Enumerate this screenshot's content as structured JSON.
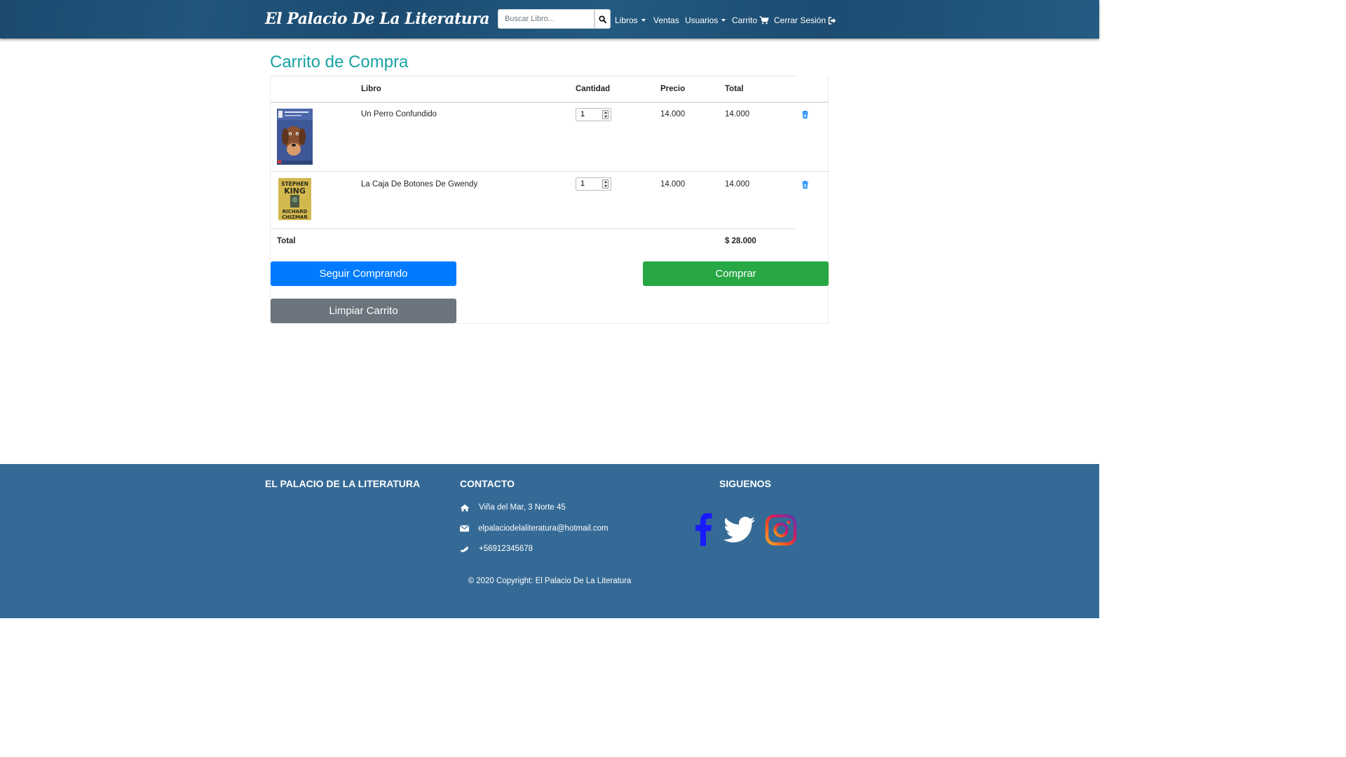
{
  "navbar": {
    "brand": "El Palacio De La Literatura",
    "search_placeholder": "Buscar Libro...",
    "items": {
      "libros": "Libros",
      "ventas": "Ventas",
      "usuarios": "Usuarios",
      "carrito": "Carrito",
      "logout": "Cerrar Sesión"
    }
  },
  "cart": {
    "title": "Carrito de Compra",
    "headers": {
      "book": "Libro",
      "quantity": "Cantidad",
      "price": "Precio",
      "total": "Total"
    },
    "rows": [
      {
        "book": "Un Perro Confundido",
        "quantity": "1",
        "price": "14.000",
        "total": "14.000",
        "cover_icon": "book-cover-dog"
      },
      {
        "book": "La Caja De Botones De Gwendy",
        "quantity": "1",
        "price": "14.000",
        "total": "14.000",
        "cover_icon": "book-cover-stephen-king"
      }
    ],
    "total_label": "Total",
    "total_value": "$ 28.000",
    "buttons": {
      "continue": "Seguir Comprando",
      "buy": "Comprar",
      "clear": "Limpiar Carrito"
    }
  },
  "footer": {
    "col1_title": "EL PALACIO DE LA LITERATURA",
    "col2_title": "CONTACTO",
    "col3_title": "SIGUENOS",
    "address": "Viña del Mar, 3 Norte 45",
    "email": "elpalaciodelaliteratura@hotmail.com",
    "phone": "+56912345678",
    "copyright": "© 2020 Copyright: El Palacio De La Literatura"
  },
  "colors": {
    "title_teal": "#17a2a2",
    "primary": "#007bff",
    "success": "#28a745",
    "secondary": "#6c757d",
    "footer_bg": "#356a96",
    "facebook": "#1a1aff"
  }
}
